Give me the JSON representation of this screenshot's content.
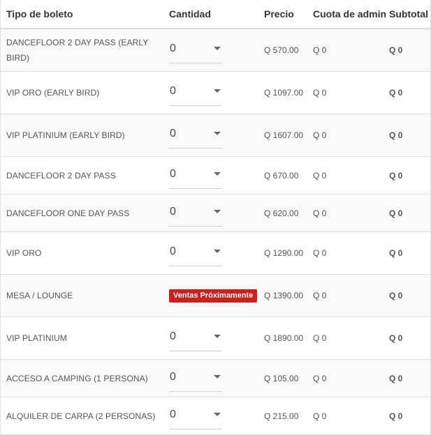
{
  "table": {
    "headers": {
      "ticket_type": "Tipo de boleto",
      "quantity": "Cantidad",
      "price": "Precio",
      "admin_fee": "Cuota de admin",
      "subtotal": "Subtotal"
    },
    "rows": [
      {
        "name": "DANCEFLOOR 2 DAY PASS (EARLY BIRD)",
        "quantity": "0",
        "price": "Q 570.00",
        "fee": "Q 0",
        "subtotal": "Q 0",
        "status": "select"
      },
      {
        "name": "VIP ORO (EARLY BIRD)",
        "quantity": "0",
        "price": "Q 1097.00",
        "fee": "Q 0",
        "subtotal": "Q 0",
        "status": "select"
      },
      {
        "name": "VIP PLATINIUM (EARLY BIRD)",
        "quantity": "0",
        "price": "Q 1607.00",
        "fee": "Q 0",
        "subtotal": "Q 0",
        "status": "select"
      },
      {
        "name": "DANCEFLOOR 2 DAY PASS",
        "quantity": "0",
        "price": "Q 670.00",
        "fee": "Q 0",
        "subtotal": "Q 0",
        "status": "select"
      },
      {
        "name": "DANCEFLOOR ONE DAY PASS",
        "quantity": "0",
        "price": "Q 620.00",
        "fee": "Q 0",
        "subtotal": "Q 0",
        "status": "select"
      },
      {
        "name": "VIP ORO",
        "quantity": "0",
        "price": "Q 1290.00",
        "fee": "Q 0",
        "subtotal": "Q 0",
        "status": "select"
      },
      {
        "name": "MESA / LOUNGE",
        "badge": "Ventas Próximamente",
        "price": "Q 1390.00",
        "fee": "Q 0",
        "subtotal": "Q 0",
        "status": "coming-soon"
      },
      {
        "name": "VIP PLATINIUM",
        "quantity": "0",
        "price": "Q 1890.00",
        "fee": "Q 0",
        "subtotal": "Q 0",
        "status": "select"
      },
      {
        "name": "ACCESO A CAMPING (1 PERSONA)",
        "quantity": "0",
        "price": "Q 105.00",
        "fee": "Q 0",
        "subtotal": "Q 0",
        "status": "select"
      },
      {
        "name": "ALQUILER DE CARPA (2 PERSONAS)",
        "quantity": "0",
        "price": "Q 215.00",
        "fee": "Q 0",
        "subtotal": "Q 0",
        "status": "select"
      }
    ]
  },
  "colors": {
    "badge_background": "#cc1f1f",
    "row_stripe": "#f9f9f9",
    "border": "#e0e0e0"
  }
}
